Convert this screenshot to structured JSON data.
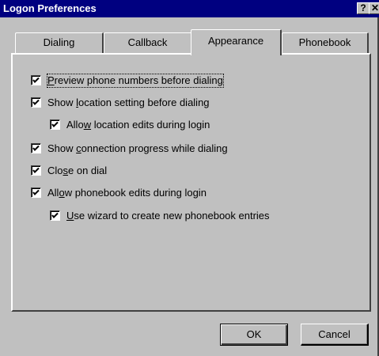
{
  "window": {
    "title": "Logon Preferences",
    "help_glyph": "?",
    "close_glyph": "✕"
  },
  "tabs": [
    {
      "label": "Dialing",
      "active": false
    },
    {
      "label": "Callback",
      "active": false
    },
    {
      "label": "Appearance",
      "active": true
    },
    {
      "label": "Phonebook",
      "active": false
    }
  ],
  "options": [
    {
      "label": "Preview phone numbers before dialing",
      "checked": true,
      "mnemonic": "P"
    },
    {
      "label": "Show location setting before dialing",
      "checked": true,
      "mnemonic": "l"
    },
    {
      "label": "Allow location edits during login",
      "checked": true,
      "mnemonic": "w"
    },
    {
      "label": "Show connection progress while dialing",
      "checked": true,
      "mnemonic": "c"
    },
    {
      "label": "Close on dial",
      "checked": true,
      "mnemonic": "s"
    },
    {
      "label": "Allow phonebook edits during login",
      "checked": true,
      "mnemonic": "o"
    },
    {
      "label": "Use wizard to create new phonebook entries",
      "checked": true,
      "mnemonic": "U"
    }
  ],
  "buttons": {
    "ok": "OK",
    "cancel": "Cancel"
  }
}
